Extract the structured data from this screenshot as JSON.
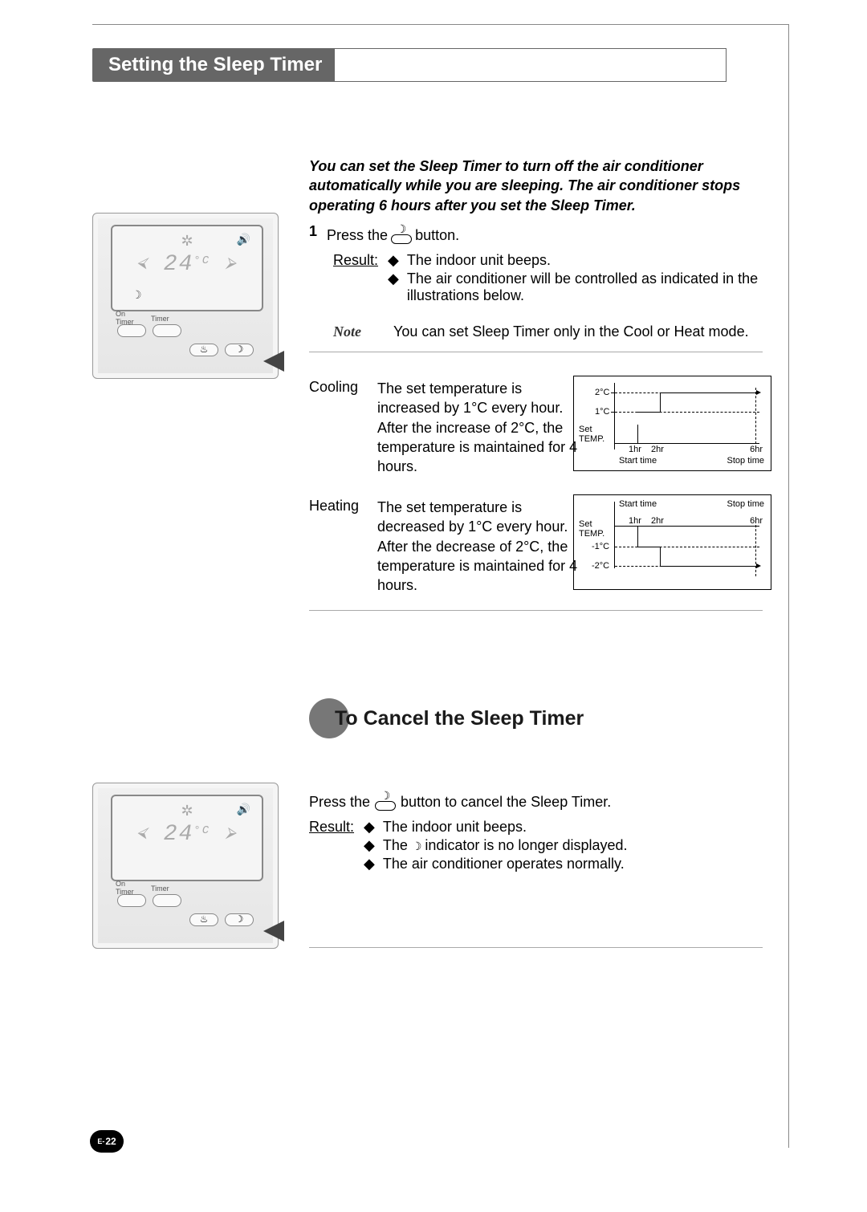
{
  "section_title": "Setting the Sleep Timer",
  "intro": "You can set the Sleep Timer to turn off the air conditioner automatically while you are sleeping. The air conditioner stops operating 6 hours after you set the Sleep Timer.",
  "step1": {
    "number": "1",
    "press_pre": "Press the",
    "press_post": "button.",
    "result_label": "Result:",
    "results": [
      "The indoor unit beeps.",
      "The air conditioner will be controlled as indicated in the illustrations below."
    ],
    "note_label": "Note",
    "note_text": "You can set Sleep Timer only in the Cool or Heat mode."
  },
  "cooling": {
    "label": "Cooling",
    "text": "The set temperature is increased by 1°C every hour. After the increase of 2°C, the temperature is maintained for 4 hours."
  },
  "heating": {
    "label": "Heating",
    "text": "The set temperature is decreased by 1°C every hour. After the decrease of 2°C, the temperature is maintained for 4 hours."
  },
  "subtitle": "To Cancel the Sleep Timer",
  "cancel": {
    "press_pre": "Press the",
    "press_post": "button to cancel the Sleep Timer.",
    "result_label": "Result:",
    "results_a": "The indoor unit beeps.",
    "results_b_pre": "The",
    "results_b_post": "indicator is no longer displayed.",
    "results_c": "The air conditioner operates normally."
  },
  "remote": {
    "temp_display": "24",
    "temp_unit": "°C",
    "on_timer_label": "On\nTimer",
    "timer_label": "Timer"
  },
  "page_number": {
    "prefix": "E-",
    "num": "22"
  },
  "chart_data": [
    {
      "type": "line",
      "title": "Cooling sleep curve",
      "x_unit": "hr",
      "y_unit": "°C relative to Set TEMP.",
      "y_labels": [
        "Set TEMP.",
        "1°C",
        "2°C"
      ],
      "x_ticks": [
        "1hr",
        "2hr",
        "6hr"
      ],
      "start_label": "Start time",
      "stop_label": "Stop time",
      "points": [
        {
          "hr": 0,
          "delta_c": 0
        },
        {
          "hr": 1,
          "delta_c": 1
        },
        {
          "hr": 2,
          "delta_c": 2
        },
        {
          "hr": 6,
          "delta_c": 2
        }
      ]
    },
    {
      "type": "line",
      "title": "Heating sleep curve",
      "x_unit": "hr",
      "y_unit": "°C relative to Set TEMP.",
      "y_labels": [
        "Set TEMP.",
        "-1°C",
        "-2°C"
      ],
      "x_ticks": [
        "1hr",
        "2hr",
        "6hr"
      ],
      "start_label": "Start time",
      "stop_label": "Stop time",
      "points": [
        {
          "hr": 0,
          "delta_c": 0
        },
        {
          "hr": 1,
          "delta_c": -1
        },
        {
          "hr": 2,
          "delta_c": -2
        },
        {
          "hr": 6,
          "delta_c": -2
        }
      ]
    }
  ]
}
